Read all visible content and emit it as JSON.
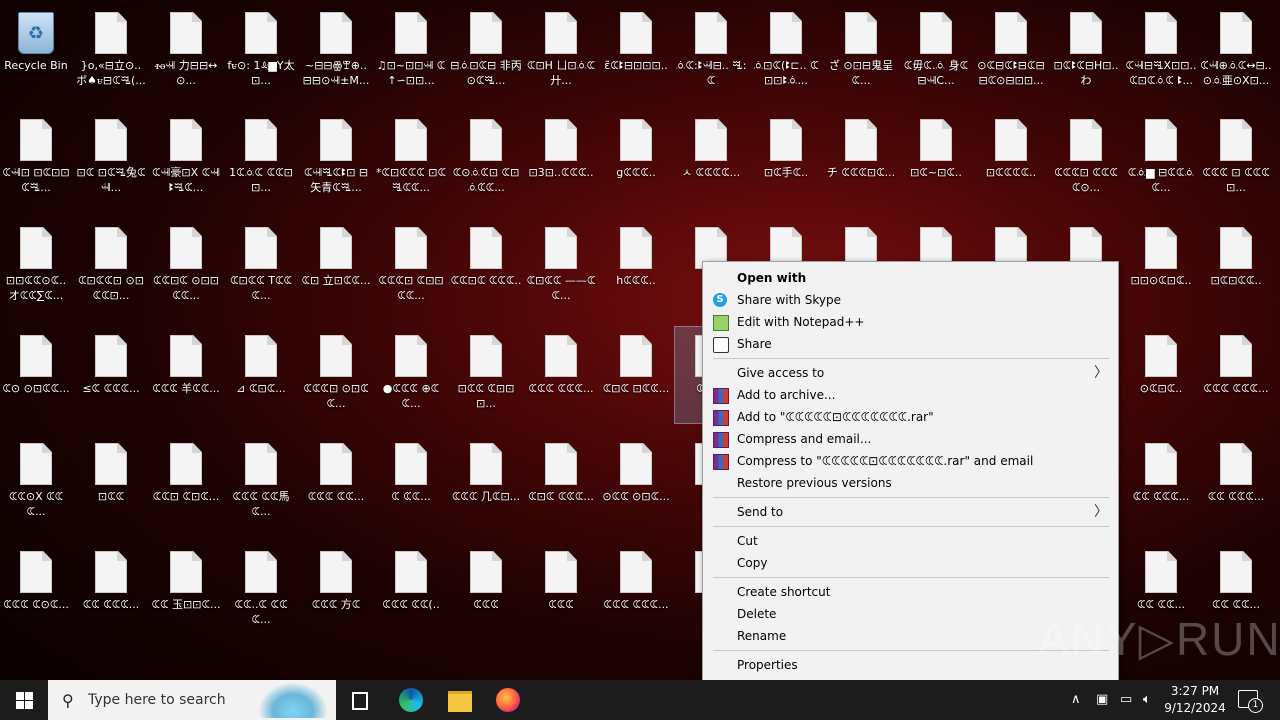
{
  "desktop": {
    "recycle_bin": "Recycle Bin",
    "rows": [
      [
        [
          "}o,«⊟立⊙..",
          "ボ♠ꮜ⊟ꕆꗆ(..."
        ],
        [
          "ꮠꮎꕝ",
          "力⊟⊟↔⊙..."
        ],
        [
          "fꮜ⊙:",
          "1ꕋ▆Y太⊡..."
        ],
        [
          "~⊟⊟ꙮꕛ⊕..",
          "⊟⊟⊙ꕝ±M..."
        ],
        [
          "♫⊡~⊡⊡ꕝ",
          "ꕆ↑∽⊡⊡..."
        ],
        [
          "⊟ꗝ⊡ꕆ⊟",
          "非丙⊙ꕆꗆ..."
        ],
        [
          "ꕆ⊡H",
          "ㄩ⊡ꗝꕆ廾..."
        ],
        [
          "ɛ̃ꕆꔪ⊟⊡⊡⊡..",
          ""
        ],
        [
          "ꗝꕆ:ꔪꕝ⊟..",
          "ꗆ:ꕆ"
        ],
        [
          "ꗝ⊡ꕆ(ꔪ⊏..",
          "ꕆ⊡⊡ꔪꗝ..."
        ],
        [
          "ざ",
          "⊙⊡⊟鬼呈ꕆ..."
        ],
        [
          "ꕆ毋ꕆ.ꗝ",
          "身ꕆ⊟ꕝC..."
        ],
        [
          "⊙ꕆ⊟ꕆꔪ⊟ꕆ⊟",
          "⊟ꕆ⊙⊟⊡⊡..."
        ],
        [
          "⊡ꕆꔪꕆ⊟H⊡..",
          "わ"
        ],
        [
          "ꕆꕝ⊟ꗆX⊡⊡..",
          "ꕆ⊡ꕆꗝꕆ ꔪ..."
        ],
        [
          "ꕆꕝ⊕ꗝꕆ↔⊟..",
          "⊙ꗝ亜⊙X⊡..."
        ]
      ],
      [
        [
          "ꕆꕝ⊡",
          "⊡ꕆ⊡⊡ꕆꗆ..."
        ],
        [
          "⊡ꕆ",
          "⊡ꕆꗆ兔ꕆꕝ..."
        ],
        [
          "ꕆꕝ豪⊡X",
          "ꕆꕝꔪꗆꕆ..."
        ],
        [
          "1ꕆꗝꕆ",
          "ꕆꕆ⊡⊡..."
        ],
        [
          "ꕆꕝꗆꕆꔪ⊡",
          "⊟矢青ꕆꗆ..."
        ],
        [
          "*ꕆ⊡ꕆꕆꕆ",
          "⊡ꕆꗆꕆꕆ..."
        ],
        [
          "ꕆ⊙ꗝꕆ⊡",
          "ꕆ⊡ꗝꕆꕆ..."
        ],
        [
          "⊡3⊡..ꕆꕆꕆ..",
          ""
        ],
        [
          "gꕆꕆꕆ..",
          ""
        ],
        [
          "ㅅ",
          "ꕆꕆꕆꕆ..."
        ],
        [
          "⊡ꕆ手ꕆ..",
          ""
        ],
        [
          "チ",
          "ꕆꕆꕆ⊡ꕆ..."
        ],
        [
          "⊡ꕆ~⊡ꕆ..",
          ""
        ],
        [
          "⊡ꕆꕆꕆꕆ..",
          ""
        ],
        [
          "ꕆꕆꕆ⊡",
          "ꕆꕆꕆꕆ⊙..."
        ],
        [
          "ꕆꗝ▆",
          "⊟ꕆꕆꗝꕆ..."
        ],
        [
          "ꕆꕆꕆ ⊡",
          "ꕆꕆꕆ⊡..."
        ]
      ],
      [
        [
          "⊡⊡ꕆꕆ⊙ꕆ..",
          "オꕆꕆ∑ꕆ..."
        ],
        [
          "ꕆ⊡ꕆꕆ⊡",
          "⊙⊡ꕆꕆ⊡..."
        ],
        [
          "ꕆꕆ⊡ꕆ",
          "⊙⊡⊡ꕆꕆ..."
        ],
        [
          "ꕆ⊡ꕆꕆ",
          "Tꕆꕆꕆ..."
        ],
        [
          "ꕆ⊡",
          "立⊡ꕆꕆ..."
        ],
        [
          "ꕆꕆꕆ⊡",
          "ꕆ⊡⊡ꕆꕆ..."
        ],
        [
          "ꕆꕆ⊡ꕆ",
          "ꕆꕆꕆ.."
        ],
        [
          "ꕆ⊡ꕆꕆ",
          "——ꕆꕆ..."
        ],
        [
          "hꕆꕆꕆ..",
          ""
        ],
        [
          "ꕆꕆ",
          ""
        ],
        [
          "",
          ""
        ],
        [
          "",
          ""
        ],
        [
          "",
          ""
        ],
        [
          "",
          ""
        ],
        [
          "",
          ""
        ],
        [
          "⊡⊡⊙ꕆ⊡ꕆ..",
          ""
        ],
        [
          "⊡ꕆ⊡ꕆꕆ..",
          ""
        ]
      ],
      [
        [
          "ꕆ⊙",
          "⊙⊡ꕆꕆ..."
        ],
        [
          "≤ꕆ",
          "ꕆꕆꕆ..."
        ],
        [
          "ꕆꕆꕆ",
          "羊ꕆꕆ..."
        ],
        [
          "⊿",
          "ꕆ⊡ꕆ..."
        ],
        [
          "ꕆꕆꕆ⊡",
          "⊙⊡ꕆꕆ..."
        ],
        [
          "●ꕆꕆꕆ",
          "⊕ꕆꕆ..."
        ],
        [
          "⊡ꕆꕆ",
          "ꕆ⊡⊡⊡..."
        ],
        [
          "ꕆꕆꕆ",
          "ꕆꕆꕆ..."
        ],
        [
          "ꕆ⊡ꕆ",
          "⊡ꕆꕆ..."
        ],
        [
          "ꕆ",
          "ꕆ⊡"
        ],
        [
          "⊙ꕆ⊡ꕆ..",
          ""
        ],
        [
          "ꕆꕆꕆ",
          "ꕆꕆꕆ..."
        ]
      ],
      [
        [
          "ꕆꕆ⊙X",
          "ꕆꕆꕆ..."
        ],
        [
          "⊡ꕆꕆ",
          ""
        ],
        [
          "ꕆꕆ⊡",
          "ꕆ⊡ꕆ..."
        ],
        [
          "ꕆꕆꕆ",
          "ꕆꕆ馬ꕆ..."
        ],
        [
          "ꕆꕆꕆ",
          "ꕆꕆ..."
        ],
        [
          "ꕆ",
          "ꕆꕆ..."
        ],
        [
          "ꕆꕆꕆ",
          "几ꕆ⊡..."
        ],
        [
          "ꕆ⊡ꕆ",
          "ꕆꕆꕆ..."
        ],
        [
          "⊙ꕆꕆ",
          "⊙⊡ꕆ..."
        ],
        [
          "⊡ꕆ",
          ""
        ],
        [
          "ꕆꕆ",
          "ꕆꕆꕆ..."
        ],
        [
          "ꕆꕆ",
          "ꕆꕆꕆ..."
        ]
      ],
      [
        [
          "ꕆꕆꕆ",
          "ꕆ⊙ꕆ..."
        ],
        [
          "ꕆꕆ",
          "ꕆꕆꕆ..."
        ],
        [
          "ꕆꕆ",
          "玉⊡⊡ꕆ..."
        ],
        [
          "ꕆꕆ..ꕆ",
          "ꕆꕆꕆ..."
        ],
        [
          "ꕆꕆꕆ",
          "方ꕆ"
        ],
        [
          "ꕆꕆꕆ",
          "ꕆꕆ(.."
        ],
        [
          "ꕆꕆꕆ",
          ""
        ],
        [
          "ꕆꕆꕆ",
          ""
        ],
        [
          "ꕆꕆꕆ",
          "ꕆꕆꕆ..."
        ],
        [
          "ꕆ",
          ""
        ],
        [
          "ꕆꕆ",
          "ꕆꕆ..."
        ],
        [
          "ꕆꕆ",
          "ꕆꕆ..."
        ]
      ]
    ]
  },
  "context_menu": {
    "open_with": "Open with",
    "share_skype": "Share with Skype",
    "edit_notepad": "Edit with Notepad++",
    "share": "Share",
    "give_access": "Give access to",
    "add_archive": "Add to archive...",
    "add_to_rar": "Add to \"ꕆꕆꕆꕆꕆ⊡ꕆꕆꕆꕆꕆꕆꕆ.rar\"",
    "compress_email": "Compress and email...",
    "compress_to_rar_email": "Compress to \"ꕆꕆꕆꕆꕆ⊡ꕆꕆꕆꕆꕆꕆꕆ.rar\" and email",
    "restore": "Restore previous versions",
    "send_to": "Send to",
    "cut": "Cut",
    "copy": "Copy",
    "create_shortcut": "Create shortcut",
    "delete": "Delete",
    "rename": "Rename",
    "properties": "Properties"
  },
  "taskbar": {
    "search_placeholder": "Type here to search",
    "time": "3:27 PM",
    "date": "9/12/2024",
    "notification_count": "1"
  },
  "watermark": "ANY▷RUN"
}
